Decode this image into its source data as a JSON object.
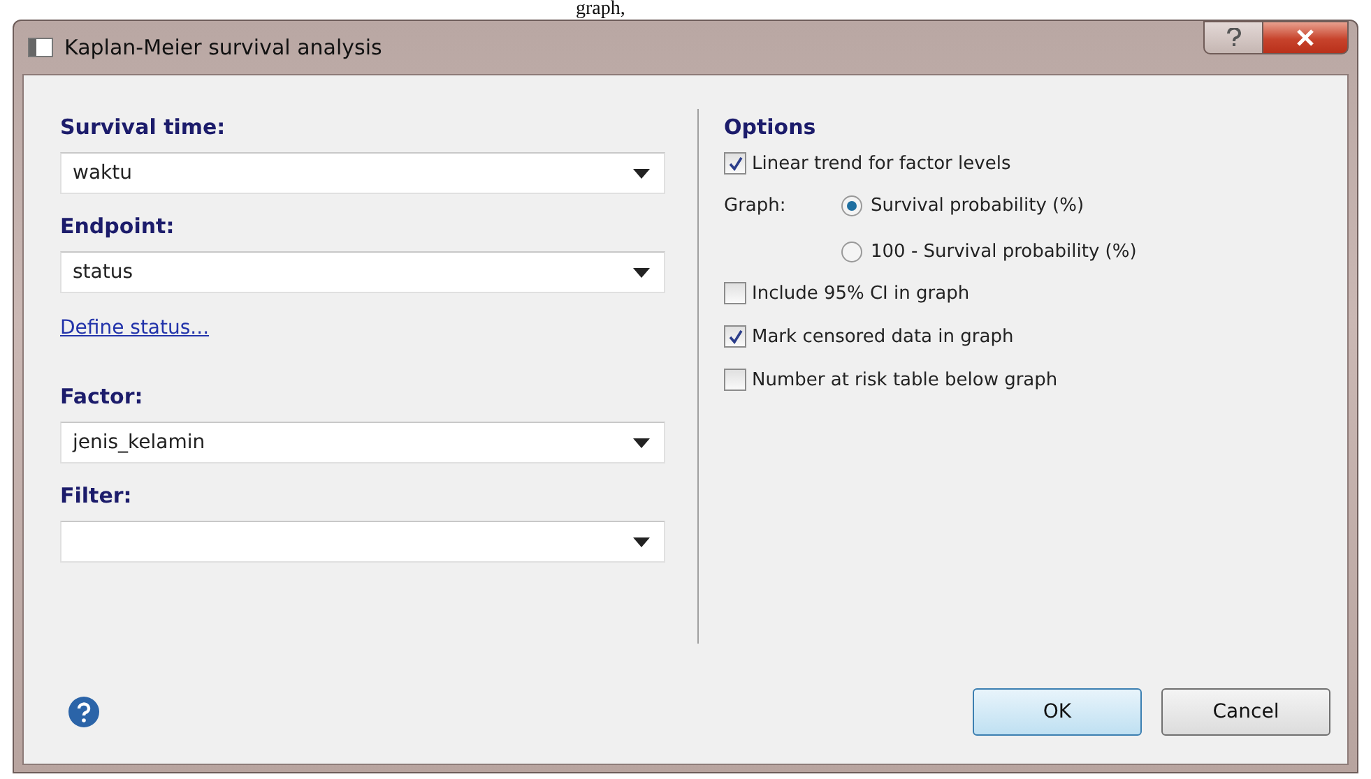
{
  "document_fragment": "graph,",
  "window": {
    "title": "Kaplan-Meier survival analysis"
  },
  "fields": [
    {
      "label": "Survival time:",
      "value": "waktu"
    },
    {
      "label": "Endpoint:",
      "value": "status",
      "link": "Define status..."
    },
    {
      "label": "Factor:",
      "value": "jenis_kelamin"
    },
    {
      "label": "Filter:"
    }
  ],
  "options": {
    "title": "Options",
    "items": [
      {
        "kind": "checkbox",
        "label": "Linear trend for factor levels",
        "checked": true
      },
      {
        "kind": "radio_group",
        "label": "Graph:",
        "choices": [
          {
            "label": "Survival probability (%)",
            "selected": true
          },
          {
            "label": "100 - Survival probability (%)",
            "selected": false
          }
        ]
      },
      {
        "kind": "checkbox",
        "label": "Include 95% CI in graph",
        "checked": false
      },
      {
        "kind": "checkbox",
        "label": "Mark censored data in graph",
        "checked": true
      },
      {
        "kind": "checkbox",
        "label": "Number at risk table below graph",
        "checked": false
      }
    ]
  },
  "buttons": [
    {
      "label": "OK",
      "default": true
    },
    {
      "label": "Cancel",
      "default": false
    }
  ]
}
